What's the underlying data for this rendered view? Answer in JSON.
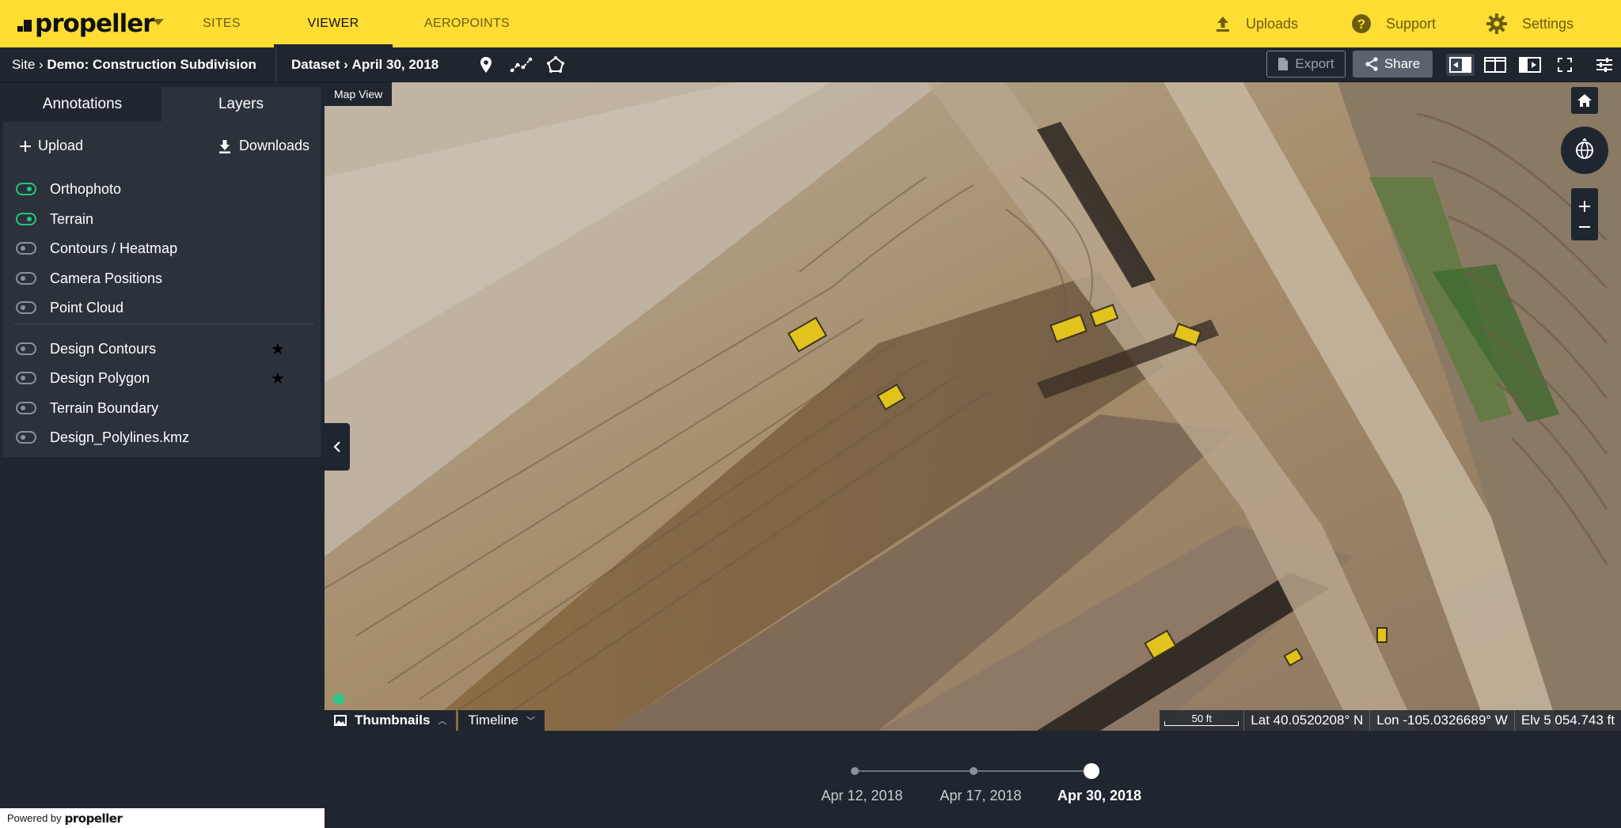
{
  "brand": {
    "name": "propeller"
  },
  "nav": {
    "tabs": [
      {
        "label": "SITES"
      },
      {
        "label": "VIEWER"
      },
      {
        "label": "AEROPOINTS"
      }
    ],
    "uploads_label": "Uploads",
    "support_label": "Support",
    "settings_label": "Settings"
  },
  "subbar": {
    "site_prefix": "Site ›",
    "site_name": "Demo: Construction Subdivision",
    "dataset_prefix": "Dataset ›",
    "dataset_date": "April 30, 2018",
    "export_label": "Export",
    "share_label": "Share"
  },
  "sidebar": {
    "tabs": {
      "annotations": "Annotations",
      "layers": "Layers"
    },
    "upload_label": "Upload",
    "downloads_label": "Downloads",
    "layers": [
      {
        "label": "Orthophoto",
        "on": true
      },
      {
        "label": "Terrain",
        "on": true
      },
      {
        "label": "Contours / Heatmap",
        "on": false
      },
      {
        "label": "Camera Positions",
        "on": false
      },
      {
        "label": "Point Cloud",
        "on": false
      }
    ],
    "design_layers": [
      {
        "label": "Design Contours",
        "on": false,
        "starred": true
      },
      {
        "label": "Design Polygon",
        "on": false,
        "starred": true
      },
      {
        "label": "Terrain Boundary",
        "on": false,
        "starred": false
      },
      {
        "label": "Design_Polylines.kmz",
        "on": false,
        "starred": false
      }
    ],
    "star_glyph": "★",
    "powered_by": "Powered by",
    "powered_brand": "propeller"
  },
  "map": {
    "view_label": "Map View",
    "thumbnails_label": "Thumbnails",
    "timeline_label": "Timeline",
    "scale_label": "50 ft",
    "lat": "Lat 40.0520208° N",
    "lon": "Lon -105.0326689° W",
    "elv": "Elv 5 054.743 ft"
  },
  "timeline": {
    "dates": [
      {
        "label": "Apr 12, 2018",
        "active": false
      },
      {
        "label": "Apr 17, 2018",
        "active": false
      },
      {
        "label": "Apr 30, 2018",
        "active": true
      }
    ]
  },
  "colors": {
    "brand_yellow": "#ffdd33",
    "dark_bg": "#1f2630",
    "toggle_on": "#22c77a"
  }
}
